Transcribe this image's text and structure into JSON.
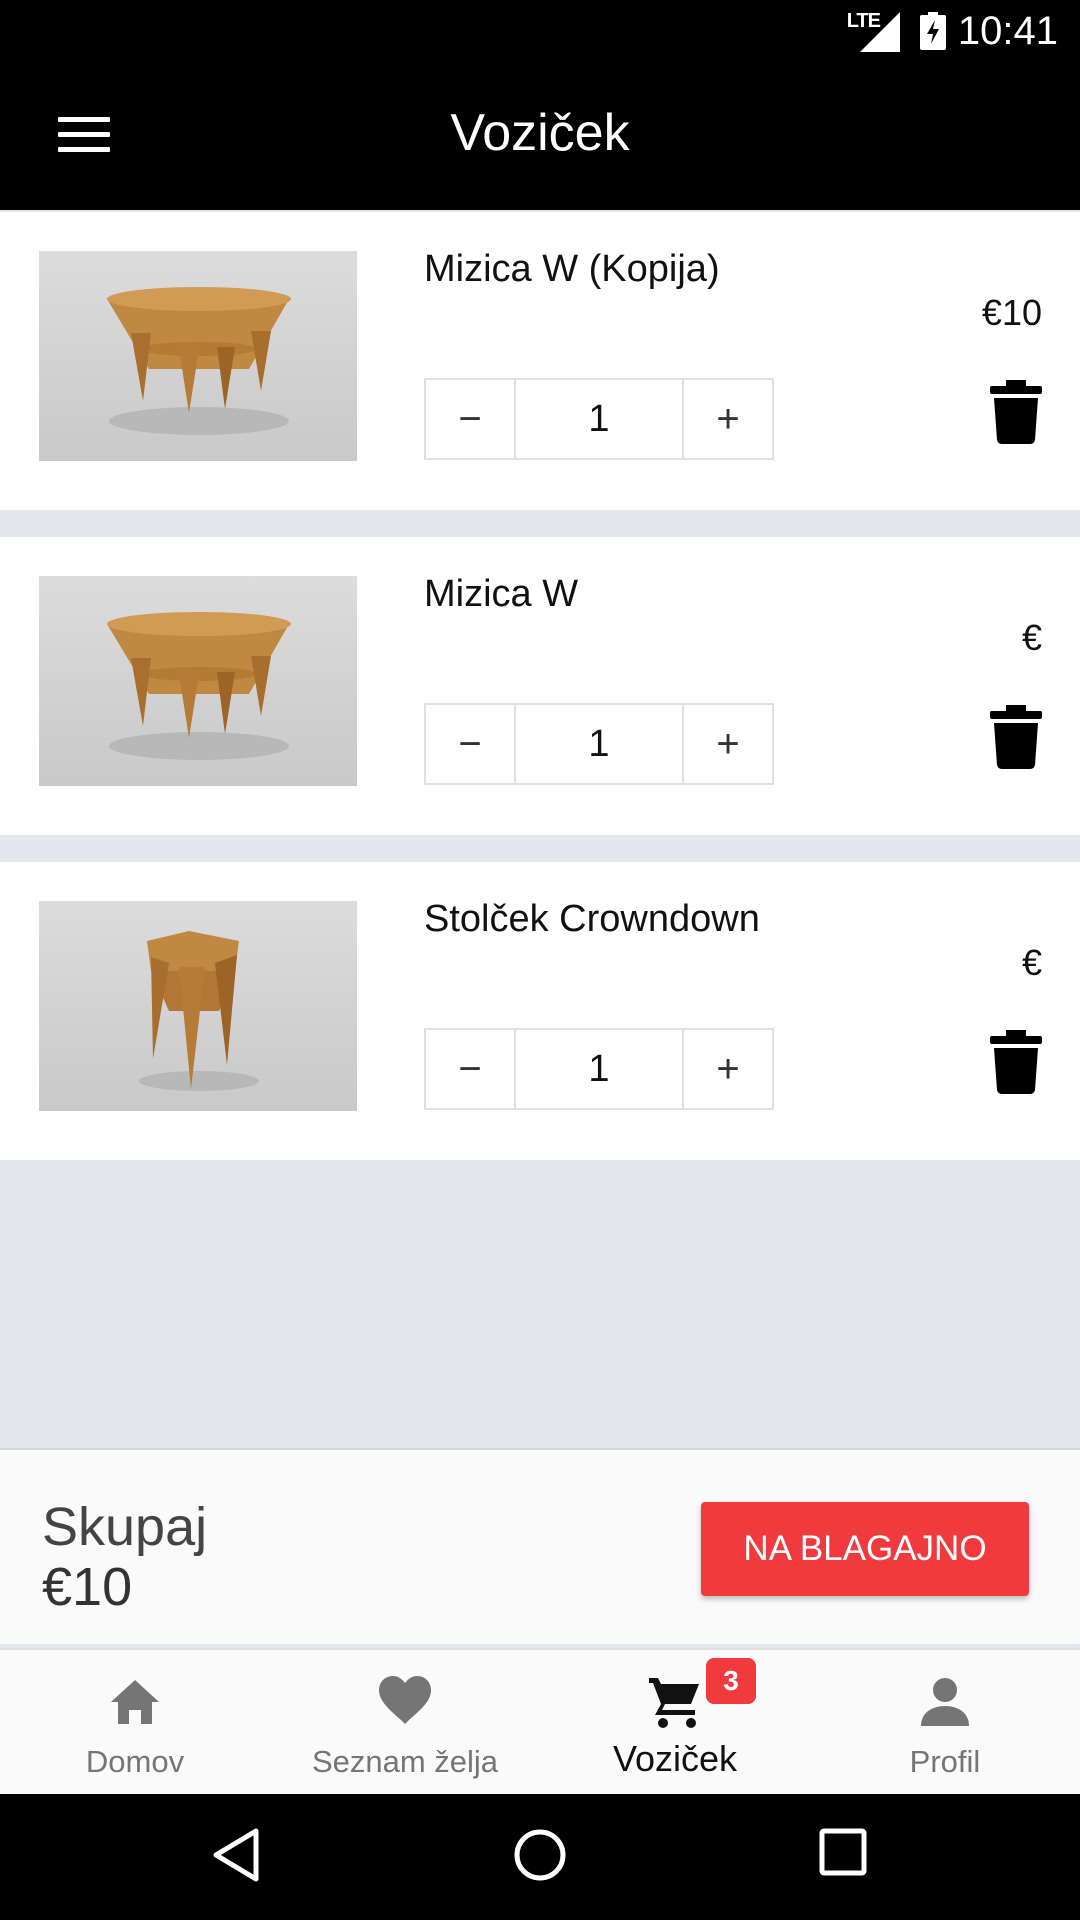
{
  "status_bar": {
    "network": "LTE",
    "time": "10:41"
  },
  "app_bar": {
    "title": "Voziček",
    "menu_icon": "menu-icon"
  },
  "cart_items": [
    {
      "name": "Mizica W (Kopija)",
      "price": "€10",
      "quantity": "1",
      "decrement": "−",
      "increment": "+"
    },
    {
      "name": "Mizica W",
      "price": "€",
      "quantity": "1",
      "decrement": "−",
      "increment": "+"
    },
    {
      "name": "Stolček Crowndown",
      "price": "€",
      "quantity": "1",
      "decrement": "−",
      "increment": "+"
    }
  ],
  "summary": {
    "label": "Skupaj",
    "total": "€10",
    "checkout_label": "NA BLAGAJNO"
  },
  "bottom_nav": [
    {
      "label": "Domov",
      "icon": "home-icon"
    },
    {
      "label": "Seznam želja",
      "icon": "heart-icon"
    },
    {
      "label": "Voziček",
      "icon": "cart-icon",
      "badge": "3",
      "active": true
    },
    {
      "label": "Profil",
      "icon": "person-icon"
    }
  ],
  "colors": {
    "accent": "#f03a3e",
    "app_bar": "#000000",
    "background": "#e3e7ec"
  }
}
